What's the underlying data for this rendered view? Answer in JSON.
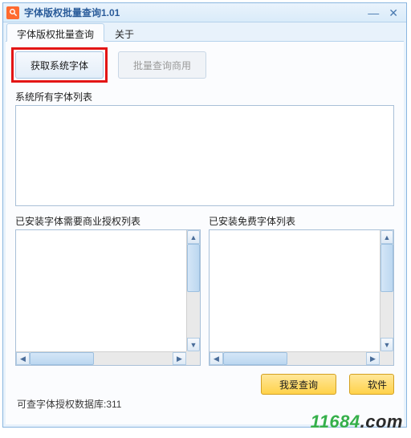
{
  "window": {
    "title": "字体版权批量查询1.01"
  },
  "tabs": {
    "main": "字体版权批量查询",
    "about": "关于"
  },
  "buttons": {
    "get_fonts": "获取系统字体",
    "batch_query": "批量查询商用"
  },
  "labels": {
    "all_fonts": "系统所有字体列表",
    "commercial_fonts": "已安装字体需要商业授权列表",
    "free_fonts": "已安装免费字体列表"
  },
  "actions": {
    "love_query": "我爱查询",
    "software": "软件"
  },
  "status": {
    "text": "可查字体授权数据库:311"
  },
  "watermark": {
    "prefix": "11684",
    "suffix": ".com"
  }
}
